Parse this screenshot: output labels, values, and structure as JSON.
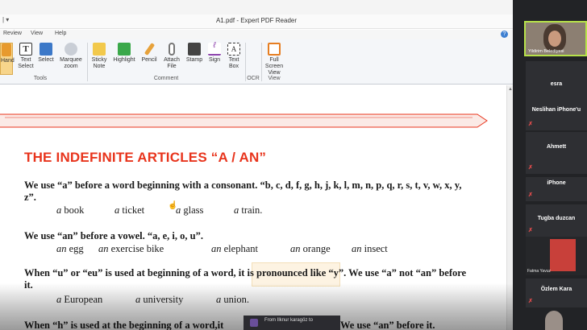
{
  "window": {
    "title": "A1.pdf - Expert PDF Reader",
    "quick_access": "| ▾"
  },
  "menu": {
    "items": [
      "Review",
      "View",
      "Help"
    ]
  },
  "ribbon": {
    "tools": [
      {
        "label": "Hand",
        "icon": "hand-icon",
        "color": "#e79a2e"
      },
      {
        "label": "Text Select",
        "icon": "text-select-icon",
        "color": "#2b2b2b"
      },
      {
        "label": "Select",
        "icon": "select-icon",
        "color": "#3b78c8"
      },
      {
        "label": "Marquee zoom",
        "icon": "zoom-icon",
        "color": "#7a7a7a"
      },
      {
        "label": "Sticky Note",
        "icon": "sticky-note-icon",
        "color": "#f2c94c"
      },
      {
        "label": "Highlight",
        "icon": "highlight-icon",
        "color": "#3aa84a"
      },
      {
        "label": "Pencil",
        "icon": "pencil-icon",
        "color": "#e7a23b"
      },
      {
        "label": "Attach File",
        "icon": "paperclip-icon",
        "color": "#777777"
      },
      {
        "label": "Stamp",
        "icon": "stamp-icon",
        "color": "#444444"
      },
      {
        "label": "Sign",
        "icon": "sign-icon",
        "color": "#8e44ad"
      },
      {
        "label": "Text Box",
        "icon": "text-box-icon",
        "color": "#2b2b2b"
      },
      {
        "label": "Full Screen View",
        "icon": "full-screen-icon",
        "color": "#e67e22"
      }
    ],
    "groups": [
      "Tools",
      "Comment",
      "OCR",
      "View"
    ]
  },
  "document": {
    "heading": "THE INDEFINITE ARTICLES “A / AN”",
    "p1": "We use “a” before a word beginning with a consonant. “b, c, d, f, g, h, j, k, l, m, n, p, q, r, s, t, v, w, x, y, z”.",
    "ex1": [
      {
        "art": "a",
        "word": "book"
      },
      {
        "art": "a",
        "word": "ticket"
      },
      {
        "art": "a",
        "word": "glass"
      },
      {
        "art": "a",
        "word": "train."
      }
    ],
    "p2": "We use “an” before a vowel. “a, e, i, o, u”.",
    "ex2": [
      {
        "art": "an",
        "word": "egg"
      },
      {
        "art": "an",
        "word": "exercise bike"
      },
      {
        "art": "an",
        "word": "elephant"
      },
      {
        "art": "an",
        "word": "orange"
      },
      {
        "art": "an",
        "word": "insect"
      }
    ],
    "p3": "When “u” or “eu” is used at beginning of a word, it is pronounced like “y”. We use “a” not “an” before it.",
    "ex3": [
      {
        "art": "a",
        "word": "European"
      },
      {
        "art": "a",
        "word": "university"
      },
      {
        "art": "a",
        "word": "union."
      }
    ],
    "p4a": "When “h” is used at the beginning of a word,it",
    "p4b": "We use “an” before it."
  },
  "chat_toast": "From Ilknur karagöz to",
  "participants": [
    {
      "name": "Yildirim Belediyesi",
      "video": true
    },
    {
      "name": "esra"
    },
    {
      "name": "Neslihan iPhone'u"
    },
    {
      "name": "Ahmett"
    },
    {
      "name": "iPhone"
    },
    {
      "name": "Tugba duzcan"
    },
    {
      "name": "Fatma Yavuz",
      "video": true
    },
    {
      "name": "Özlem Kara"
    }
  ],
  "colors": {
    "heading_red": "#e8341c",
    "active_speaker": "#b7e24a",
    "muted_red": "#e24c4c"
  }
}
